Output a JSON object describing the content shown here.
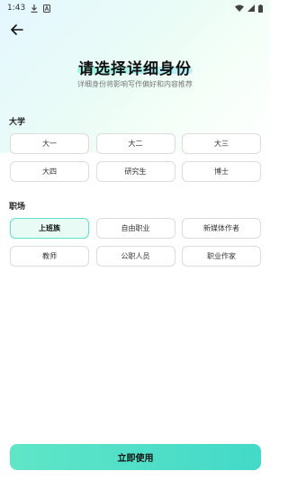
{
  "status_bar": {
    "time": "1:43",
    "download_icon": "download-icon",
    "a_icon": "a-badge-icon",
    "wifi_icon": "wifi-icon",
    "signal_icon": "signal-icon",
    "battery_icon": "battery-icon"
  },
  "header": {
    "back_icon": "arrow-left-icon",
    "title": "请选择详细身份",
    "subtitle": "详细身份将影响写作偏好和内容推荐"
  },
  "sections": [
    {
      "label": "大学",
      "options": [
        "大一",
        "大二",
        "大三",
        "大四",
        "研究生",
        "博士"
      ]
    },
    {
      "label": "职场",
      "options": [
        "上班族",
        "自由职业",
        "新媒体作者",
        "教师",
        "公职人员",
        "职业作家"
      ]
    }
  ],
  "selected": "上班族",
  "colors": {
    "accent": "#5de3c6",
    "accent_bg": "#e8fbf5",
    "button_gradient_start": "#5fe6c7",
    "button_gradient_end": "#43d9c8"
  },
  "confirm_button": "立即使用"
}
